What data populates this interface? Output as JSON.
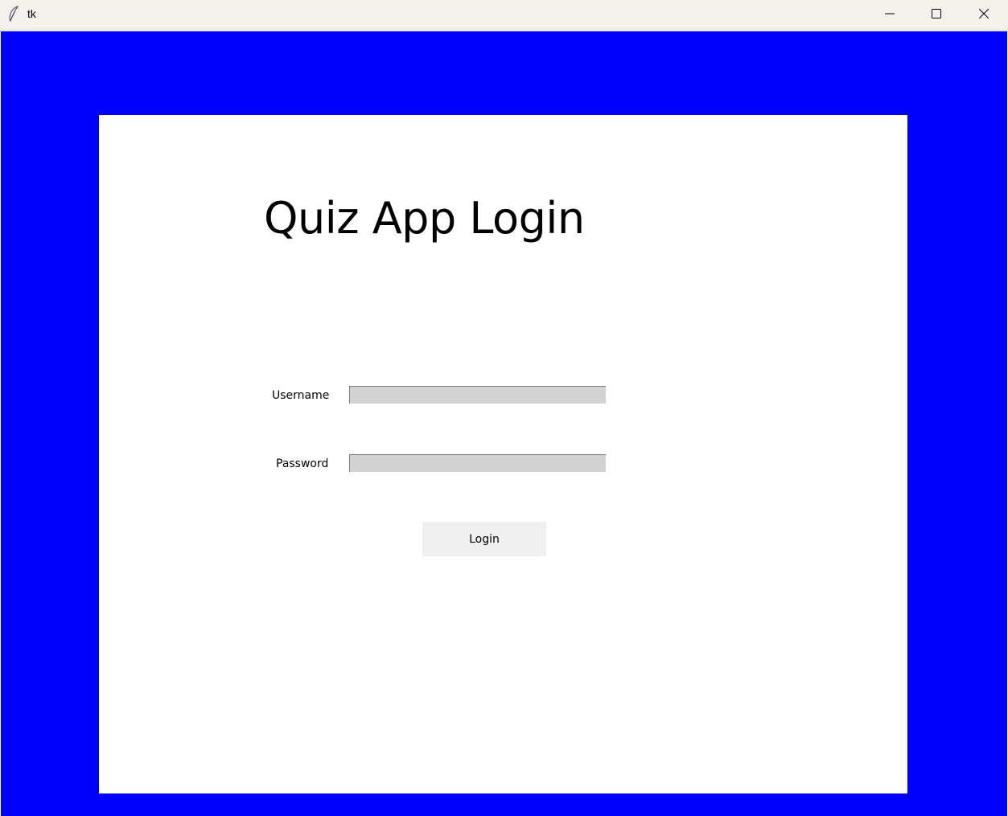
{
  "window": {
    "title": "tk",
    "icon": "tk-feather-icon",
    "controls": {
      "minimize": "minimize-icon",
      "maximize": "maximize-icon",
      "close": "close-icon"
    }
  },
  "colors": {
    "background": "#0000ff",
    "card": "#ffffff",
    "entry_background": "#d3d3d3",
    "button_background": "#f0f0f0"
  },
  "login": {
    "heading": "Quiz App Login",
    "username_label": "Username",
    "username_value": "",
    "password_label": "Password",
    "password_value": "",
    "button_label": "Login"
  }
}
